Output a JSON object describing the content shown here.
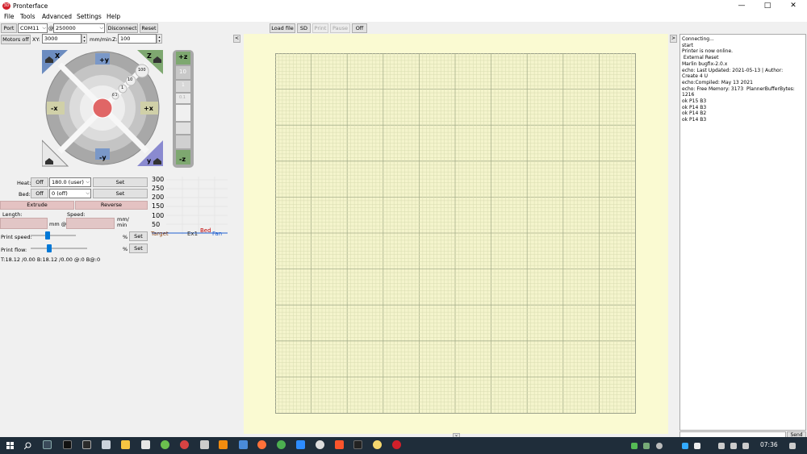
{
  "window": {
    "title": "Pronterface",
    "minimize": "—",
    "maximize": "□",
    "close": "✕",
    "app_icon_text": "3D"
  },
  "menu": [
    "File",
    "Tools",
    "Advanced",
    "Settings",
    "Help"
  ],
  "connection": {
    "port_label": "Port",
    "port_value": "COM11",
    "at": "@",
    "baud_value": "250000",
    "disconnect_label": "Disconnect",
    "reset_label": "Reset"
  },
  "motors": {
    "motors_off_label": "Motors off",
    "xy_label": "XY:",
    "xy_speed": "3000",
    "units": "mm/min",
    "z_label": "Z:",
    "z_speed": "100"
  },
  "jog": {
    "home_x": "X",
    "y_plus": "+y",
    "home_z": "Z",
    "x_minus": "-x",
    "x_plus": "+x",
    "y_minus": "-y",
    "home_y": "y",
    "steps": [
      "100",
      "10",
      "1",
      "0.1"
    ],
    "z_plus": "+z",
    "z_minus": "-z",
    "z_steps": [
      "10",
      "1",
      "0.1"
    ]
  },
  "temps": {
    "heat_label": "Heat:",
    "heat_off": "Off",
    "heat_value": "180.0 (user)",
    "heat_set": "Set",
    "bed_label": "Bed:",
    "bed_off": "Off",
    "bed_value": "0 (off)",
    "bed_set": "Set"
  },
  "extrude": {
    "extrude_label": "Extrude",
    "reverse_label": "Reverse",
    "length_label": "Length:",
    "speed_label": "Speed:",
    "mm_at": "mm @",
    "mm_min": "mm/\nmin"
  },
  "print_speed": {
    "label": "Print speed:",
    "pct": "%",
    "set": "Set"
  },
  "print_flow": {
    "label": "Print flow:",
    "pct": "%",
    "set": "Set"
  },
  "status_text": "T:18.12 /0.00 B:18.12 /0.00 @:0 B@:0",
  "graph": {
    "ticks": [
      "300",
      "250",
      "200",
      "150",
      "100",
      "50"
    ],
    "legend": [
      "Target",
      "Ex1",
      "Bed",
      "Fan"
    ],
    "colors": [
      "#8b4513",
      "#2a2a2a",
      "#c00000",
      "#1f5fd0"
    ]
  },
  "toolbar": {
    "load_file": "Load file",
    "sd": "SD",
    "print": "Print",
    "pause": "Pause",
    "off": "Off",
    "collapse_left": "<",
    "collapse_right": ">",
    "expand_down": "⌄"
  },
  "console_lines": [
    "Connecting...",
    "start",
    "Printer is now online.",
    " External Reset",
    "Marlin bugfix-2.0.x",
    "echo: Last Updated: 2021-05-13 | Author:",
    "Create 4 U",
    "echo:Compiled: May 13 2021",
    "echo: Free Memory: 3173  PlannerBufferBytes:",
    "1216",
    "ok P15 B3",
    "ok P14 B3",
    "ok P14 B2",
    "ok P14 B3"
  ],
  "send_label": "Send",
  "taskbar": {
    "clock": "07:36",
    "search_icon": "search-icon",
    "start_icon": "windows-start-icon"
  }
}
